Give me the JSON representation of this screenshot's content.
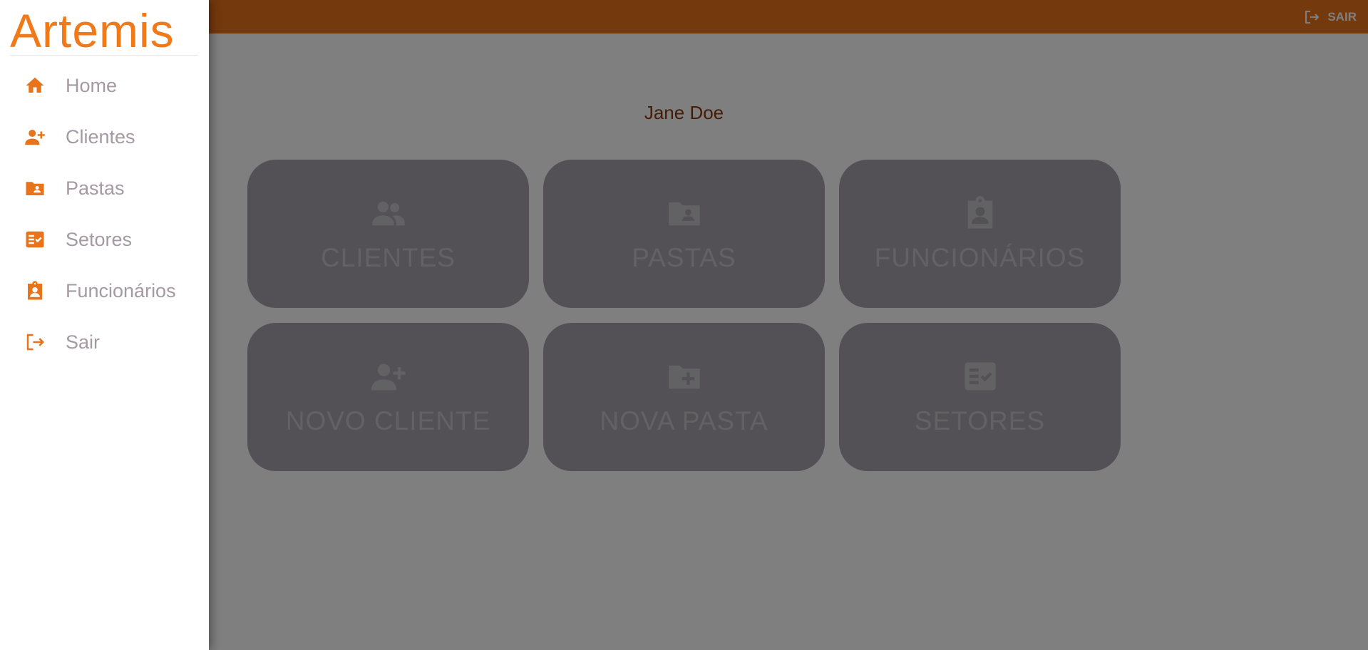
{
  "app": {
    "brand": "Artemis",
    "topbar_title": "Artemis",
    "logout_label": "SAIR",
    "user_name": "Jane Doe"
  },
  "sidebar": {
    "items": [
      {
        "label": "Home",
        "icon": "home-icon"
      },
      {
        "label": "Clientes",
        "icon": "person-add-icon"
      },
      {
        "label": "Pastas",
        "icon": "folder-shared-icon"
      },
      {
        "label": "Setores",
        "icon": "fact-check-icon"
      },
      {
        "label": "Funcionários",
        "icon": "badge-icon"
      },
      {
        "label": "Sair",
        "icon": "logout-icon"
      }
    ]
  },
  "tiles": [
    {
      "label": "CLIENTES",
      "icon": "people-icon"
    },
    {
      "label": "PASTAS",
      "icon": "folder-shared-icon"
    },
    {
      "label": "FUNCIONÁRIOS",
      "icon": "badge-icon"
    },
    {
      "label": "NOVO CLIENTE",
      "icon": "person-add-icon"
    },
    {
      "label": "NOVA PASTA",
      "icon": "create-folder-icon"
    },
    {
      "label": "SETORES",
      "icon": "fact-check-icon"
    }
  ],
  "colors": {
    "accent": "#e9731b",
    "tile_background": "#a9a3ad",
    "user_name": "#8a3a0c"
  }
}
